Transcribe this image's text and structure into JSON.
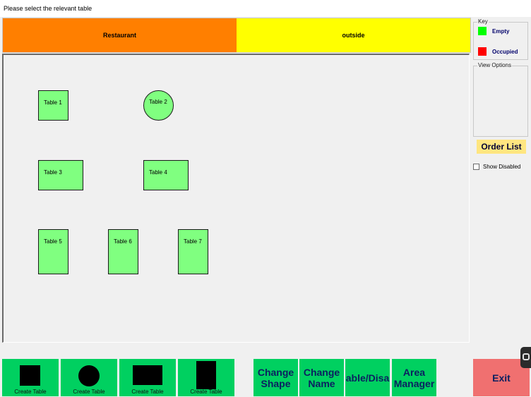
{
  "prompt": "Please select the relevant table",
  "areas": [
    {
      "label": "Restaurant",
      "color": "#ff7f00"
    },
    {
      "label": "outside",
      "color": "#ffff00"
    }
  ],
  "tables": [
    {
      "label": "Table 1",
      "shape": "square"
    },
    {
      "label": "Table 2",
      "shape": "round"
    },
    {
      "label": "Table 3",
      "shape": "wide"
    },
    {
      "label": "Table 4",
      "shape": "wide"
    },
    {
      "label": "Table 5",
      "shape": "tall"
    },
    {
      "label": "Table 6",
      "shape": "tall"
    },
    {
      "label": "Table 7",
      "shape": "tall"
    }
  ],
  "key": {
    "legend": "Key",
    "items": [
      {
        "label": "Empty",
        "color": "#00ff00"
      },
      {
        "label": "Occupied",
        "color": "#ff0000"
      }
    ]
  },
  "view_options": {
    "legend": "View Options"
  },
  "order_list_label": "Order List",
  "show_disabled": {
    "label": "Show Disabled",
    "checked": false
  },
  "create_buttons": [
    {
      "label": "Create Table",
      "shape": "square-icon"
    },
    {
      "label": "Create Table",
      "shape": "circle-icon"
    },
    {
      "label": "Create Table",
      "shape": "wide-rect-icon"
    },
    {
      "label": "Create Table",
      "shape": "tall-rect-icon"
    }
  ],
  "actions": {
    "change_shape": "Change\nShape",
    "change_name": "Change\nName",
    "enable_disable": "able/Disa",
    "area_manager": "Area\nManager",
    "exit": "Exit"
  }
}
